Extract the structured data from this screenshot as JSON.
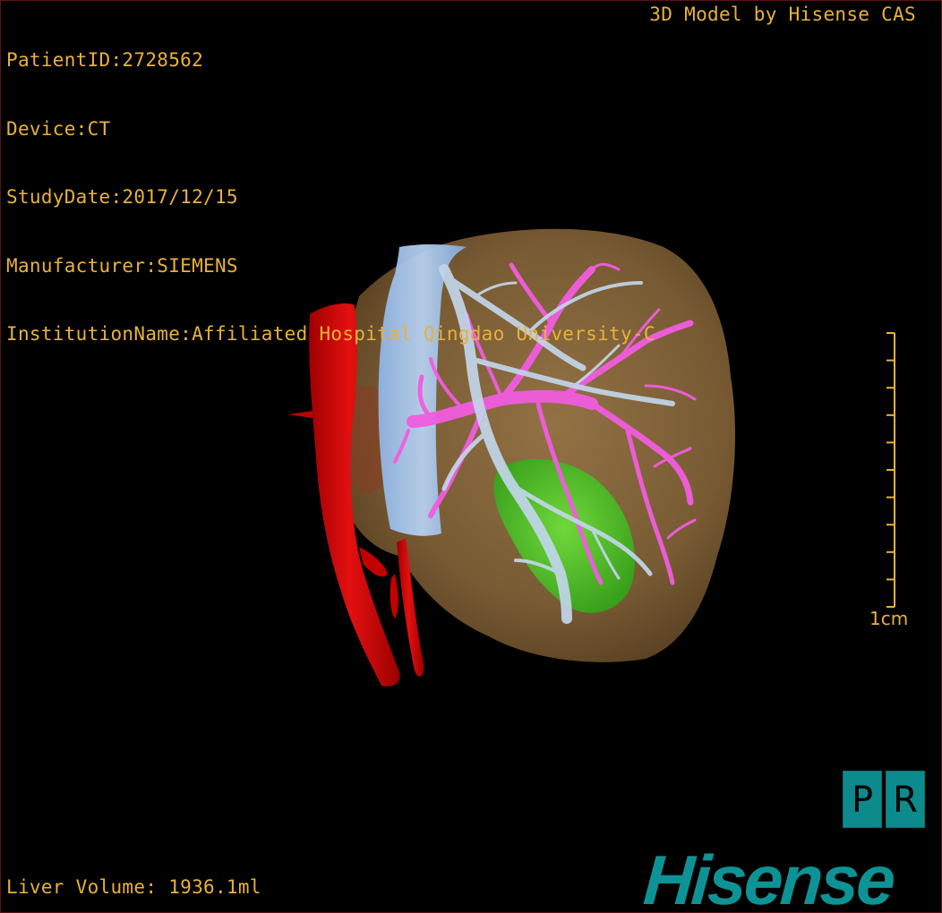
{
  "patient_info": {
    "lines": [
      "PatientID:2728562",
      "Device:CT",
      "StudyDate:2017/12/15",
      "Manufacturer:SIEMENS",
      "InstitutionName:Affiliated Hospital Qingdao University-C"
    ]
  },
  "watermark": "3D Model by Hisense CAS",
  "scale_bar": {
    "label": "1cm",
    "ticks": 10
  },
  "liver_volume": "Liver Volume: 1936.1ml",
  "view_buttons": [
    "P",
    "R"
  ],
  "logo": "Hisense",
  "colors": {
    "text": "#e8b23a",
    "liver": "#8a6a3c",
    "artery": "#d10000",
    "vena_cava": "#7aaee6",
    "portal_vein": "#f25ce0",
    "hepatic_vein": "#b8d2e8",
    "lesion": "#4fd02a",
    "brand": "#0d9396"
  },
  "structures": [
    "liver",
    "aorta",
    "inferior-vena-cava",
    "portal-vein",
    "hepatic-vein",
    "gallbladder"
  ]
}
